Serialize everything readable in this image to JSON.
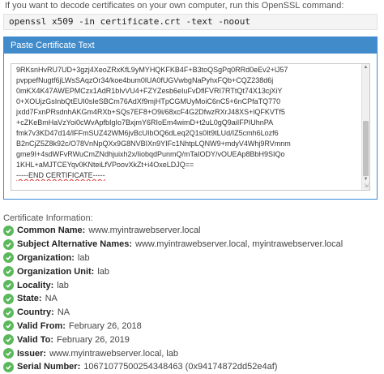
{
  "intro_text": "If you want to decode certificates on your own computer, run this OpenSSL command:",
  "command": "openssl x509 -in certificate.crt -text -noout",
  "panel": {
    "title": "Paste Certificate Text",
    "lines": [
      "9RKsnHvRU7UD+3gzj4XeoZRxKfL9yMYHQKFKB4F+B3toQSgPq0RRd0eEv2+lJ57",
      "pvppefNugtf6jLWsSAqzOr34/koe4bum0lUA0fUGVwbgNaPyhxFQb+CQZ238d6j",
      "0mKX4K47AWEPMCzx1AdR1bIvVU4+FZYZesb6eIuFvDflFVRI7RTtQt74X13cjXiY",
      "0+XOUjzGsInbQtEUI0sIeSBCm76AdXf9mjHTpCGMUyMoiC6nC5+6nCPfaTQ770",
      "jxdd7FxnPRsdnhAKGm4RXb+SQs7EF8+O9i/68xcF4G2DfwzRXrJ48XS+lQFKVTf5",
      "+cZKeBmHaVzYoi0cWvApfbIgIo7BxjmY6RIoEm4wimD+t2uL0gQ9aiIFPIUhnPA",
      "fmk7v3KD47d14/lFFmSUZ42WM6jvBcUIbOQ6dLeq2Q1s0It9tLUd/IZ5cmh6Lozf6",
      "B2nCjZ5Z8k92c/O78VnNpQXx9G8NVBIXn9YIFc1NhtpLQNW9+mdyV4Whj9RVmnm",
      "gme9I+4sdWFvRWuCmZNdhjuixh2x/IiobqdPunmQ/mTaIODY/vOUEAp8BbH9SIQo",
      "1KHL+aMJTCEYqv0KNteiLfVPoovXkZt+i4OxeLDJQ=="
    ],
    "end_line": "-----END CERTIFICATE-----"
  },
  "info_title": "Certificate Information:",
  "fields": [
    {
      "label": "Common Name:",
      "value": "www.myintrawebserver.local"
    },
    {
      "label": "Subject Alternative Names:",
      "value": "www.myintrawebserver.local, myintrawebserver.local"
    },
    {
      "label": "Organization:",
      "value": "lab"
    },
    {
      "label": "Organization Unit:",
      "value": "lab"
    },
    {
      "label": "Locality:",
      "value": "lab"
    },
    {
      "label": "State:",
      "value": "NA"
    },
    {
      "label": "Country:",
      "value": "NA"
    },
    {
      "label": "Valid From:",
      "value": "February 26, 2018"
    },
    {
      "label": "Valid To:",
      "value": "February 26, 2019"
    },
    {
      "label": "Issuer:",
      "value": "www.myintrawebserver.local, lab"
    },
    {
      "label": "Serial Number:",
      "value": "10671077500254348463 (0x94174872dd52e4af)"
    }
  ],
  "colors": {
    "accent": "#428bca",
    "check": "#5cb85c"
  },
  "icons": {
    "field_status": "check-circle-icon"
  }
}
